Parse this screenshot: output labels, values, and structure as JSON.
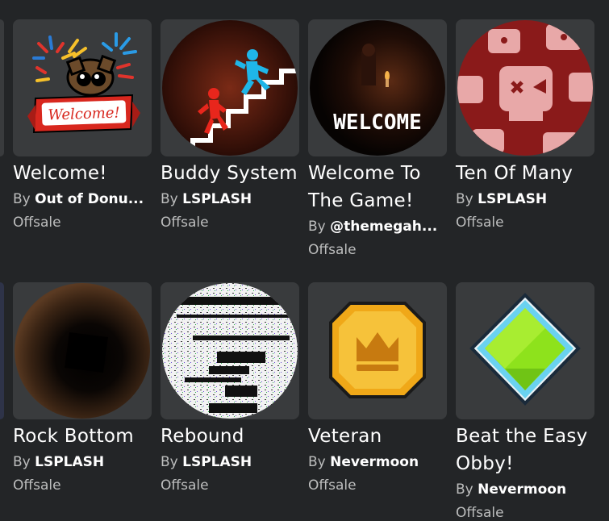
{
  "badges": [
    {
      "title": "Welcome!",
      "by": "By",
      "creator": "Out of Donu...",
      "price": "Offsale",
      "icon": "welcome-sign-icon",
      "sign_text": "Welcome!"
    },
    {
      "title": "Buddy System",
      "by": "By",
      "creator": "LSPLASH",
      "price": "Offsale",
      "icon": "stairs-figures-icon"
    },
    {
      "title": "Welcome To The Game!",
      "by": "By",
      "creator": "@themegah...",
      "price": "Offsale",
      "icon": "dark-welcome-icon",
      "sign_text": "WELCOME"
    },
    {
      "title": "Ten Of Many",
      "by": "By",
      "creator": "LSPLASH",
      "price": "Offsale",
      "icon": "skull-pattern-icon"
    },
    {
      "title": "Rock Bottom",
      "by": "By",
      "creator": "LSPLASH",
      "price": "Offsale",
      "icon": "dark-hole-icon"
    },
    {
      "title": "Rebound",
      "by": "By",
      "creator": "LSPLASH",
      "price": "Offsale",
      "icon": "static-noise-icon"
    },
    {
      "title": "Veteran",
      "by": "By",
      "creator": "Nevermoon",
      "price": "Offsale",
      "icon": "gold-crown-gem-icon"
    },
    {
      "title": "Beat the Easy Obby!",
      "by": "By",
      "creator": "Nevermoon",
      "price": "Offsale",
      "icon": "green-gem-icon"
    }
  ],
  "colors": {
    "background": "#232527",
    "card": "#393b3d",
    "text_primary": "#ffffff",
    "text_secondary": "#bdbebe"
  }
}
